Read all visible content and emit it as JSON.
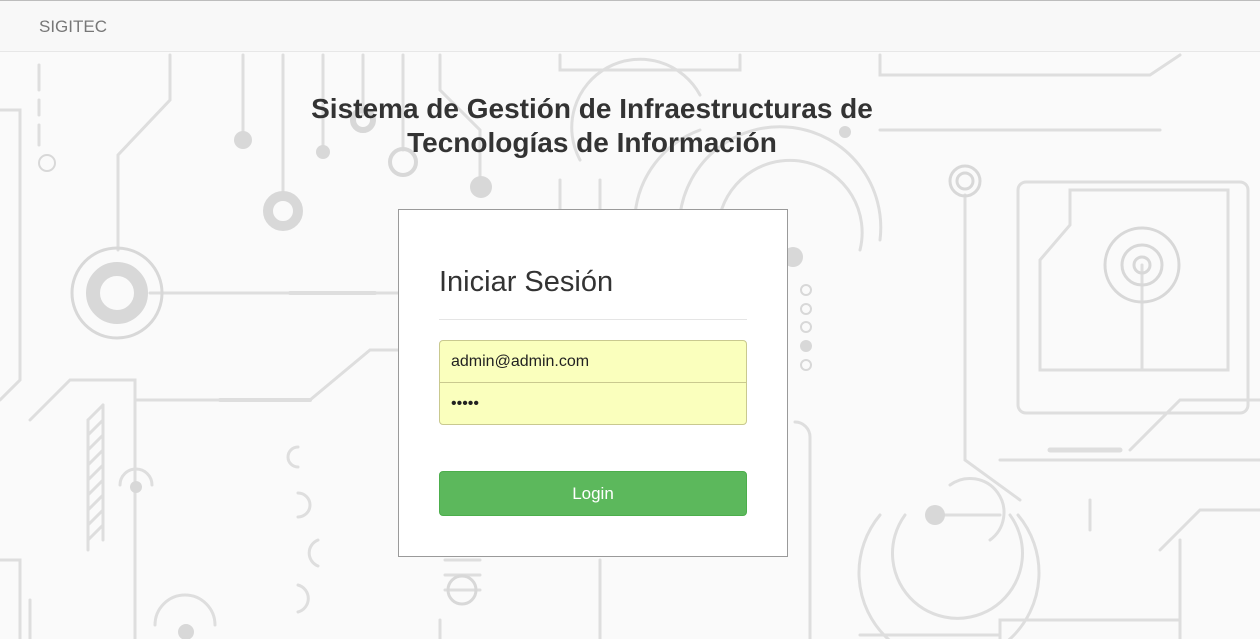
{
  "navbar": {
    "brand": "SIGITEC"
  },
  "page": {
    "title_line1": "Sistema de Gestión de Infraestructuras de",
    "title_line2": "Tecnologías de Información"
  },
  "login": {
    "heading": "Iniciar Sesión",
    "email_value": "admin@admin.com",
    "password_value": "•••••",
    "submit_label": "Login"
  },
  "colors": {
    "background": "#fafafa",
    "navbar_bg": "#f8f8f8",
    "autofill_bg": "#faffbd",
    "button_green": "#5cb85c",
    "circuit_lines": "#d6d6d6"
  },
  "icons": {
    "background_pattern": "circuit-board-pattern"
  }
}
